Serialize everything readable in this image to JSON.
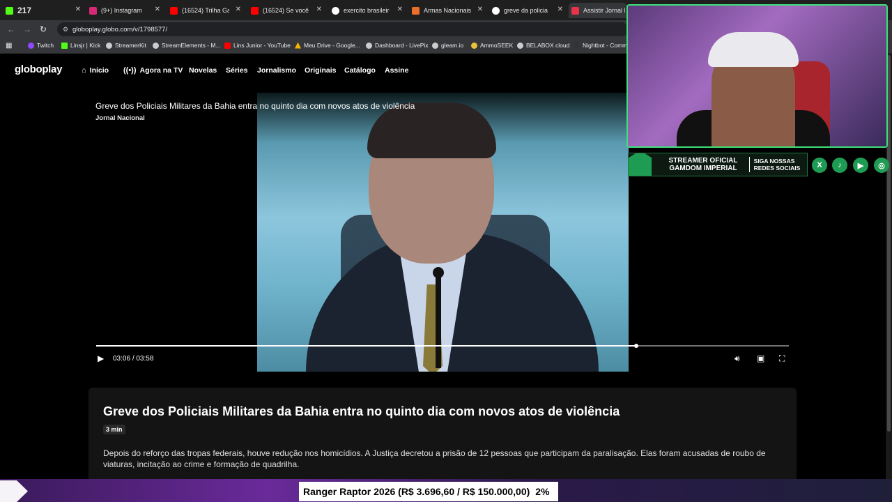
{
  "browser": {
    "tabs": [
      {
        "label": "217",
        "favicon_color": "#53fc18",
        "active": false
      },
      {
        "label": "(9+) Instagram",
        "favicon_color": "#d62976",
        "active": false
      },
      {
        "label": "(16524) Trilha Galop",
        "favicon_color": "#ff0000",
        "active": false
      },
      {
        "label": "(16524) Se você us",
        "favicon_color": "#ff0000",
        "active": false
      },
      {
        "label": "exercito brasileiro",
        "favicon_color": "#ffffff",
        "active": false
      },
      {
        "label": "Armas Nacionais: V",
        "favicon_color": "#e8702a",
        "active": false
      },
      {
        "label": "greve da policia na",
        "favicon_color": "#ffffff",
        "active": false
      },
      {
        "label": "Assistir Jornal N",
        "favicon_color": "#e8334a",
        "active": true
      }
    ],
    "url": "globoplay.globo.com/v/1798577/",
    "bookmarks": [
      {
        "label": "Twitch",
        "color": "#9146ff"
      },
      {
        "label": "Linsjr | Kick",
        "color": "#53fc18"
      },
      {
        "label": "StreamerKit",
        "color": "#cccccc"
      },
      {
        "label": "StreamElements - M...",
        "color": "#cccccc"
      },
      {
        "label": "Lins Junior - YouTube",
        "color": "#ff0000"
      },
      {
        "label": "Meu Drive - Google...",
        "color": "#f4b400"
      },
      {
        "label": "Dashboard - LivePix",
        "color": "#cccccc"
      },
      {
        "label": "gleam.io",
        "color": "#cccccc"
      },
      {
        "label": "AmmoSEEK",
        "color": "#e8c23a"
      },
      {
        "label": "BELABOX cloud",
        "color": "#cccccc"
      },
      {
        "label": "Nightbot - Comm",
        "color": "#333333"
      }
    ]
  },
  "site": {
    "logo": "globoplay",
    "nav": [
      {
        "label": "Início",
        "icon": "home-icon"
      },
      {
        "label": "Agora na TV",
        "icon": "live-broadcast-icon"
      },
      {
        "label": "Novelas"
      },
      {
        "label": "Séries"
      },
      {
        "label": "Jornalismo"
      },
      {
        "label": "Originais"
      },
      {
        "label": "Catálogo"
      },
      {
        "label": "Assine"
      }
    ]
  },
  "player": {
    "title": "Greve dos Policiais Militares da Bahia entra no quinto dia com novos atos de violência",
    "program": "Jornal Nacional",
    "current_time": "03:06",
    "separator": "/",
    "duration": "03:58",
    "progress_fraction": 0.78
  },
  "card": {
    "title": "Greve dos Policiais Militares da Bahia entra no quinto dia com novos atos de violência",
    "duration_badge": "3 min",
    "description": "Depois do reforço das tropas federais, houve redução nos homicídios. A Justiça decretou a prisão de 12 pessoas que participam da paralisação. Elas foram acusadas de roubo de viaturas, incitação ao crime e formação de quadrilha."
  },
  "overlay": {
    "banner_line1": "STREAMER OFICIAL",
    "banner_line2": "GAMDOM IMPERIAL",
    "banner_right1": "SIGA NOSSAS",
    "banner_right2": "REDES SOCIAIS",
    "socials": [
      "x-icon",
      "tiktok-icon",
      "youtube-icon",
      "instagram-icon"
    ],
    "ticker_text": "Ranger Raptor 2026 (R$ 3.696,60 / R$ 150.000,00)",
    "ticker_pct": "2%"
  }
}
